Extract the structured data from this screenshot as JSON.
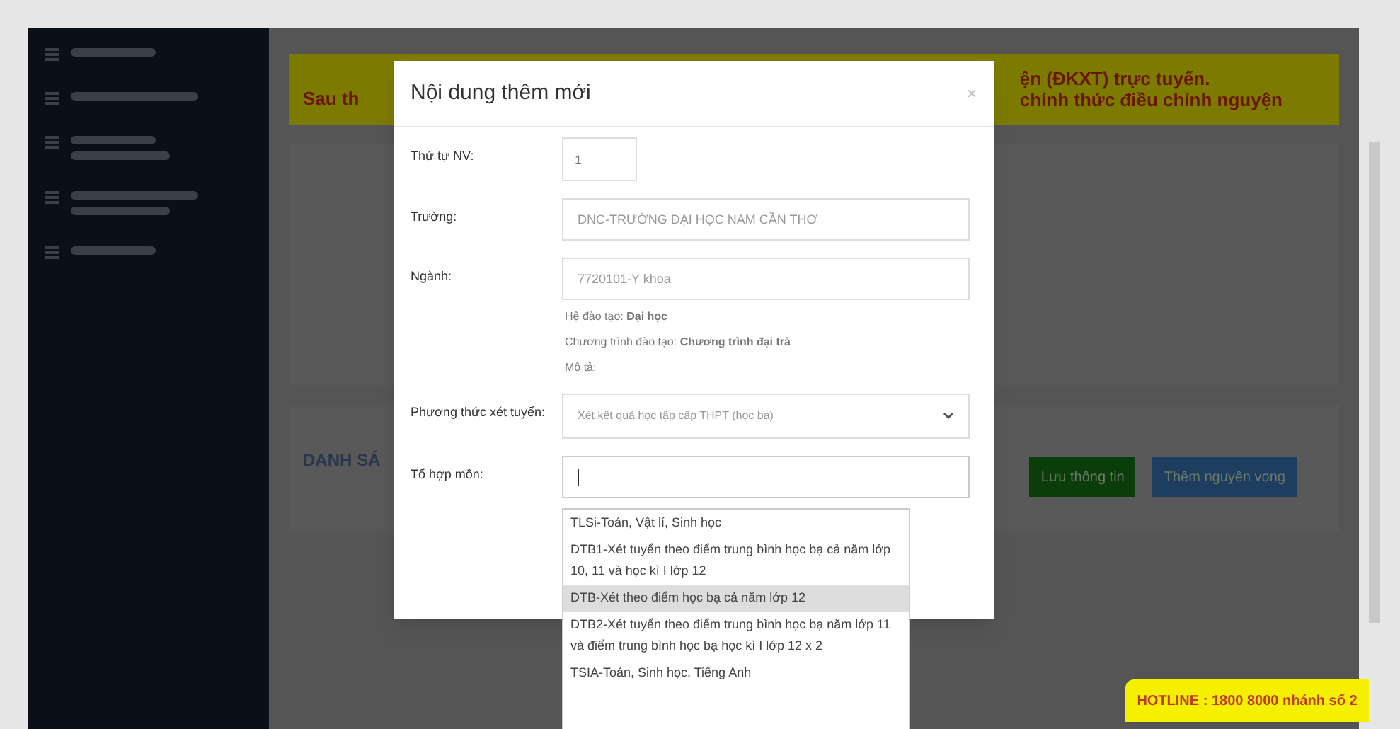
{
  "sidebar": {
    "items": [
      {
        "selected": false
      },
      {
        "selected": false
      },
      {
        "selected": false
      },
      {
        "selected": false
      },
      {
        "selected": false
      }
    ]
  },
  "banner": {
    "lines": [
      "Sau th",
      "ện (ĐKXT) trực tuyến.",
      "chính thức điều chỉnh nguyện"
    ]
  },
  "list_section": {
    "title": "DANH SÁ",
    "buttons": [
      {
        "label": "Lưu thông tin",
        "kind": "save"
      },
      {
        "label": "Thêm nguyện vọng",
        "kind": "add"
      }
    ]
  },
  "modal": {
    "title": "Nội dung thêm mới",
    "close": "×",
    "fields": [
      {
        "label": "Thứ tự NV:",
        "kind": "short",
        "value": "1"
      },
      {
        "label": "Trường:",
        "kind": "text",
        "value": "DNC-TRƯỜNG ĐẠI HỌC NAM CẦN THƠ"
      },
      {
        "label": "Ngành:",
        "kind": "text",
        "value": "7720101-Y khoa",
        "notes": [
          "Hệ đào tạo: **Đại học**",
          "Chương trình đào tạo: **Chương trình đại trà**",
          "Mô tả:"
        ]
      },
      {
        "label": "Phương thức xét tuyển:",
        "kind": "select",
        "value": "Xét kết quả học tập cấp THPT (học bạ)"
      },
      {
        "label": "Tổ hợp môn:",
        "kind": "combo"
      }
    ],
    "dropdown": [
      {
        "label": "TLSi-Toán, Vật lí, Sinh học",
        "selected": false
      },
      {
        "label": "DTB1-Xét tuyển theo điểm trung bình học bạ cả năm lớp 10, 11 và học kì I lớp 12",
        "selected": false
      },
      {
        "label": "DTB-Xét theo điểm học bạ cả năm lớp 12",
        "selected": true
      },
      {
        "label": "DTB2-Xét tuyển theo điểm trung bình học bạ năm lớp 11 và điểm trung bình học bạ học kì I lớp 12 x 2",
        "selected": false
      },
      {
        "label": "TSIA-Toán, Sinh học, Tiếng Anh",
        "selected": false
      }
    ]
  },
  "hotline": "HOTLINE : 1800 8000 nhánh số 2"
}
